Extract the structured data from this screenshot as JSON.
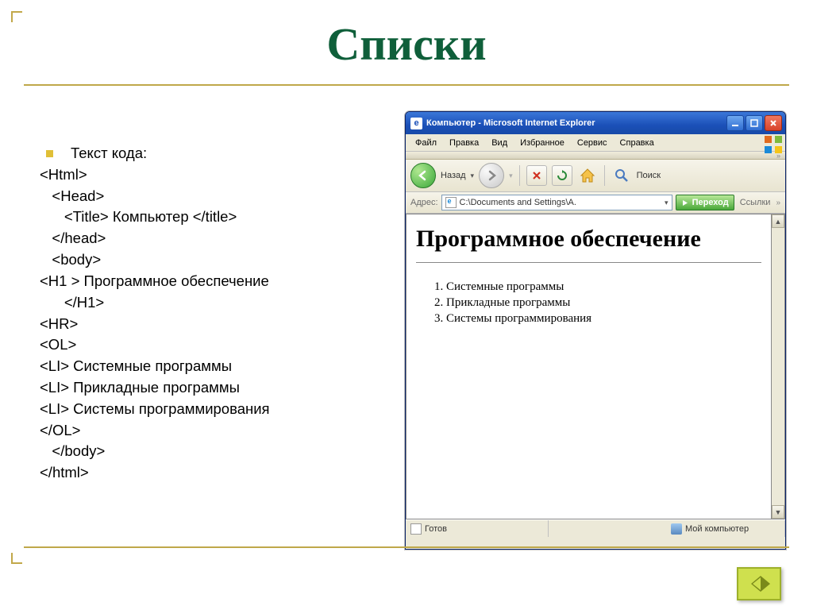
{
  "slide": {
    "title": "Списки",
    "bullet_label": "Текст кода:",
    "code_lines": [
      "<Html>",
      "   <Head>",
      "      <Title> Компьютер </title>",
      "   </head>",
      "   <body>",
      "<H1 > Программное обеспечение",
      "      </H1>",
      "<HR>",
      "<OL>",
      "<LI> Системные программы",
      "<LI> Прикладные программы",
      "<LI> Системы программирования",
      "</OL>",
      "   </body>",
      "</html>"
    ]
  },
  "ie": {
    "title": "Компьютер - Microsoft Internet Explorer",
    "menu": {
      "file": "Файл",
      "edit": "Правка",
      "view": "Вид",
      "favorites": "Избранное",
      "tools": "Сервис",
      "help": "Справка"
    },
    "toolbar": {
      "back": "Назад",
      "search": "Поиск"
    },
    "address": {
      "label": "Адрес:",
      "value": "C:\\Documents and Settings\\А.",
      "go": "Переход",
      "links": "Ссылки"
    },
    "page": {
      "heading": "Программное обеспечение",
      "items": [
        "Системные программы",
        "Прикладные программы",
        "Системы программирования"
      ]
    },
    "status": {
      "ready": "Готов",
      "zone": "Мой компьютер"
    }
  },
  "nav": {
    "next": "next"
  }
}
